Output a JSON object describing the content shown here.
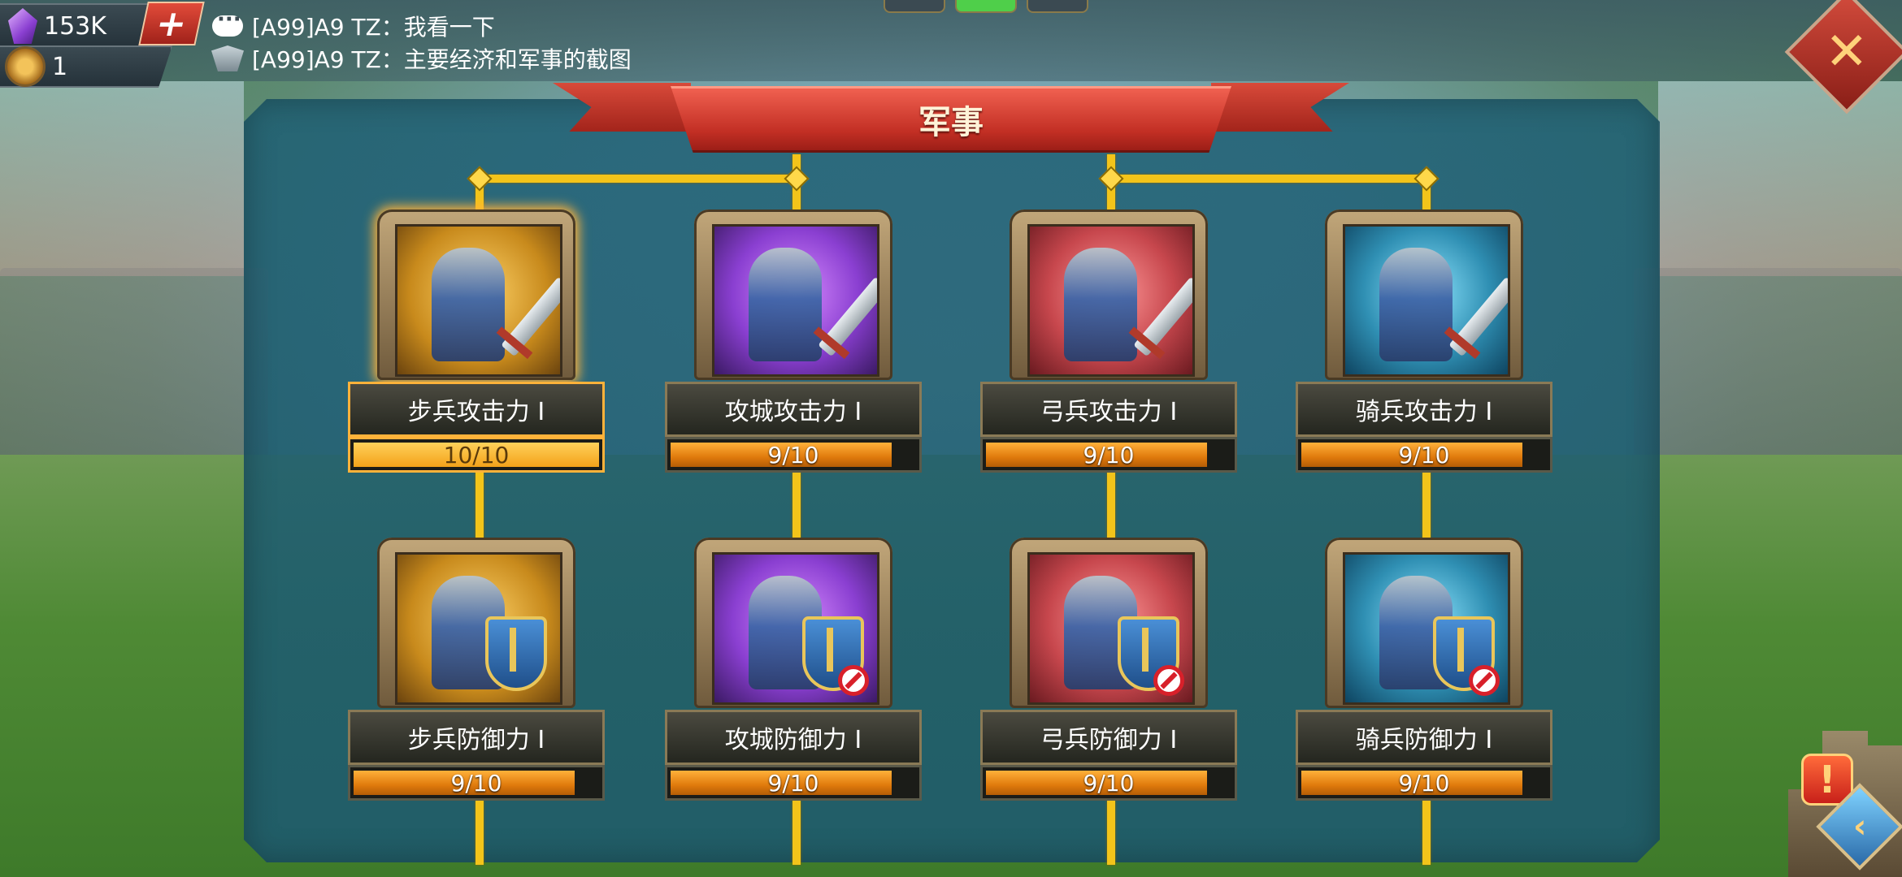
{
  "resources": {
    "gems": "153K",
    "medals": "1",
    "add_label": "+"
  },
  "chat": {
    "lines": [
      {
        "icon": "chat-bubble-icon",
        "text": "[A99]A9 TZ：我看一下"
      },
      {
        "icon": "guild-wing-icon",
        "text": "[A99]A9 TZ：主要经济和军事的截图"
      }
    ]
  },
  "close_label": "✕",
  "panel": {
    "title": "军事"
  },
  "skills": [
    {
      "name": "步兵攻击力 I",
      "progress": "10/10",
      "fraction": 1.0,
      "theme": "gold",
      "type": "attack",
      "selected": true
    },
    {
      "name": "攻城攻击力 I",
      "progress": "9/10",
      "fraction": 0.9,
      "theme": "purple",
      "type": "attack"
    },
    {
      "name": "弓兵攻击力 I",
      "progress": "9/10",
      "fraction": 0.9,
      "theme": "red",
      "type": "attack"
    },
    {
      "name": "骑兵攻击力 I",
      "progress": "9/10",
      "fraction": 0.9,
      "theme": "teal",
      "type": "attack"
    },
    {
      "name": "步兵防御力 I",
      "progress": "9/10",
      "fraction": 0.9,
      "theme": "gold",
      "type": "defense"
    },
    {
      "name": "攻城防御力 I",
      "progress": "9/10",
      "fraction": 0.9,
      "theme": "purple",
      "type": "defense-locked"
    },
    {
      "name": "弓兵防御力 I",
      "progress": "9/10",
      "fraction": 0.9,
      "theme": "red",
      "type": "defense-locked"
    },
    {
      "name": "骑兵防御力 I",
      "progress": "9/10",
      "fraction": 0.9,
      "theme": "teal",
      "type": "defense-locked"
    }
  ],
  "side": {
    "alert_label": "!",
    "nav_label": "‹"
  },
  "colors": {
    "connector": "#f3c41a",
    "ribbon": "#c22f24",
    "progress_fill": "#e07a0c",
    "panel": "#1e5f73"
  }
}
